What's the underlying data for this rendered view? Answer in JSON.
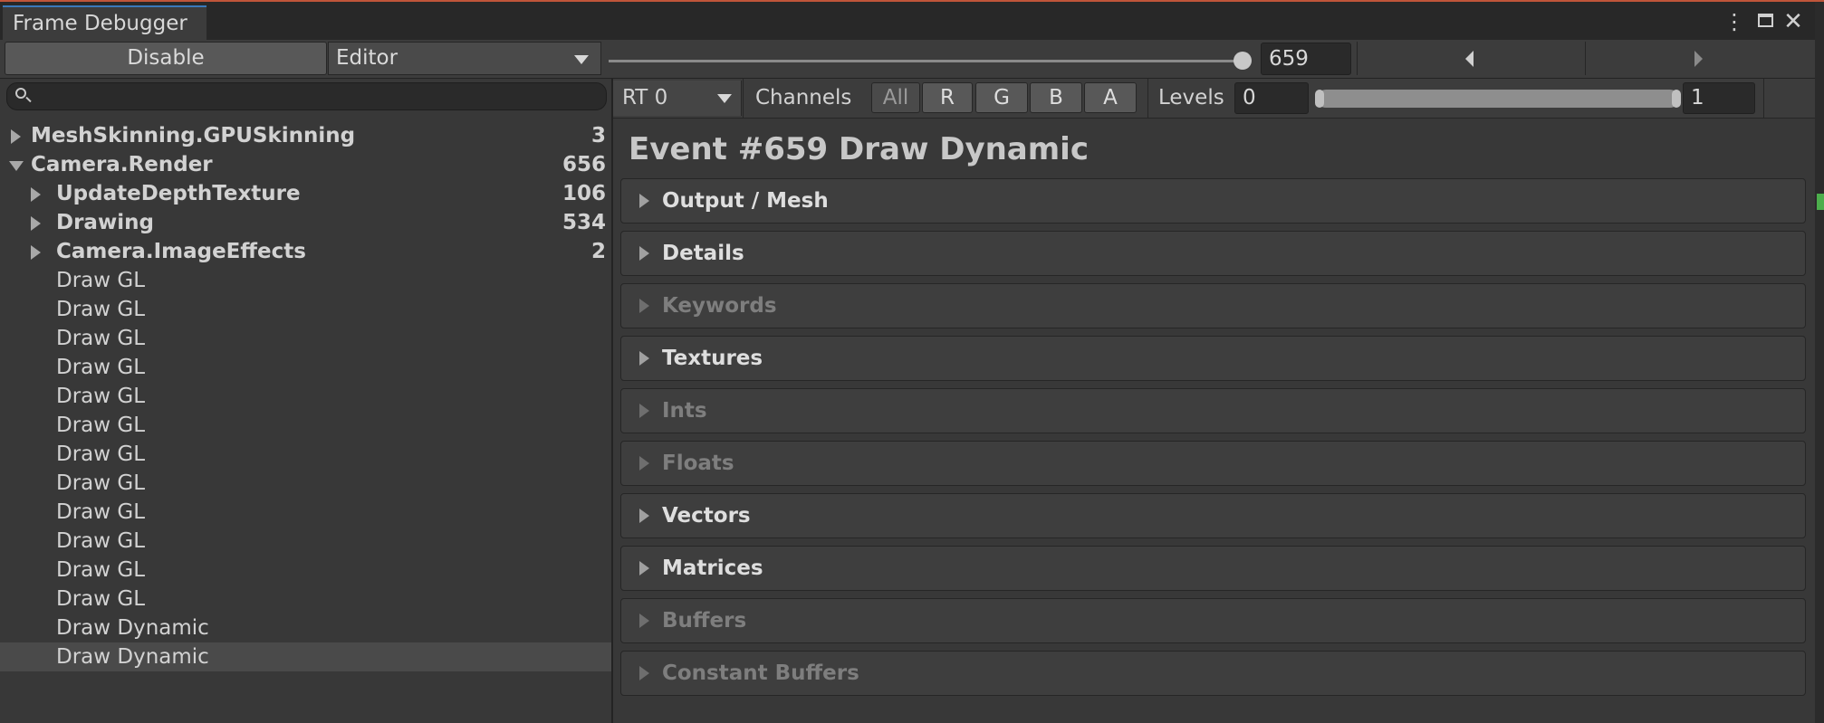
{
  "window": {
    "tab_title": "Frame Debugger"
  },
  "toolbar": {
    "disable_label": "Disable",
    "target_value": "Editor",
    "event_index": "659",
    "slider_fraction": 0.985
  },
  "search": {
    "placeholder": ""
  },
  "tree": {
    "rows": [
      {
        "label": "MeshSkinning.GPUSkinning",
        "count": "3",
        "level": 0,
        "fold": "right",
        "bold": true
      },
      {
        "label": "Camera.Render",
        "count": "656",
        "level": 0,
        "fold": "down",
        "bold": true
      },
      {
        "label": "UpdateDepthTexture",
        "count": "106",
        "level": 1,
        "fold": "right",
        "bold": true
      },
      {
        "label": "Drawing",
        "count": "534",
        "level": 1,
        "fold": "right",
        "bold": true
      },
      {
        "label": "Camera.ImageEffects",
        "count": "2",
        "level": 1,
        "fold": "right",
        "bold": true
      },
      {
        "label": "Draw GL",
        "count": "",
        "level": 1,
        "fold": "",
        "bold": false
      },
      {
        "label": "Draw GL",
        "count": "",
        "level": 1,
        "fold": "",
        "bold": false
      },
      {
        "label": "Draw GL",
        "count": "",
        "level": 1,
        "fold": "",
        "bold": false
      },
      {
        "label": "Draw GL",
        "count": "",
        "level": 1,
        "fold": "",
        "bold": false
      },
      {
        "label": "Draw GL",
        "count": "",
        "level": 1,
        "fold": "",
        "bold": false
      },
      {
        "label": "Draw GL",
        "count": "",
        "level": 1,
        "fold": "",
        "bold": false
      },
      {
        "label": "Draw GL",
        "count": "",
        "level": 1,
        "fold": "",
        "bold": false
      },
      {
        "label": "Draw GL",
        "count": "",
        "level": 1,
        "fold": "",
        "bold": false
      },
      {
        "label": "Draw GL",
        "count": "",
        "level": 1,
        "fold": "",
        "bold": false
      },
      {
        "label": "Draw GL",
        "count": "",
        "level": 1,
        "fold": "",
        "bold": false
      },
      {
        "label": "Draw GL",
        "count": "",
        "level": 1,
        "fold": "",
        "bold": false
      },
      {
        "label": "Draw GL",
        "count": "",
        "level": 1,
        "fold": "",
        "bold": false
      },
      {
        "label": "Draw Dynamic",
        "count": "",
        "level": 1,
        "fold": "",
        "bold": false
      },
      {
        "label": "Draw Dynamic",
        "count": "",
        "level": 1,
        "fold": "",
        "bold": false,
        "selected": true
      }
    ]
  },
  "render_target": {
    "rt_value": "RT 0",
    "channels_label": "Channels",
    "channels": [
      "All",
      "R",
      "G",
      "B",
      "A"
    ],
    "levels_label": "Levels",
    "levels_min": "0",
    "levels_max": "1"
  },
  "event": {
    "title": "Event #659 Draw Dynamic",
    "sections": [
      {
        "name": "Output / Mesh",
        "enabled": true
      },
      {
        "name": "Details",
        "enabled": true
      },
      {
        "name": "Keywords",
        "enabled": false
      },
      {
        "name": "Textures",
        "enabled": true
      },
      {
        "name": "Ints",
        "enabled": false
      },
      {
        "name": "Floats",
        "enabled": false
      },
      {
        "name": "Vectors",
        "enabled": true
      },
      {
        "name": "Matrices",
        "enabled": true
      },
      {
        "name": "Buffers",
        "enabled": false
      },
      {
        "name": "Constant Buffers",
        "enabled": false
      }
    ]
  },
  "colors": {
    "accent_tab": "#3a79bb",
    "frame_border": "#c0553a",
    "panel_bg": "#383838"
  }
}
